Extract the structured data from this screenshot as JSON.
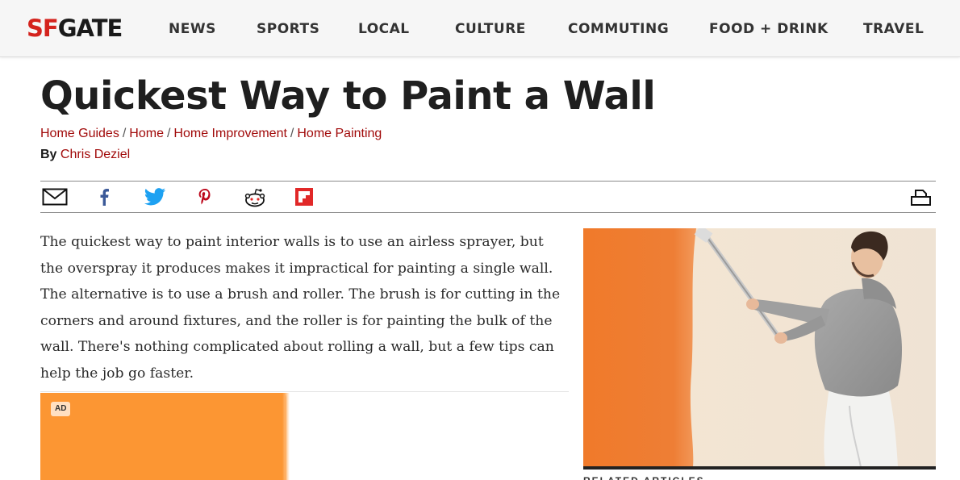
{
  "header": {
    "logo_sf": "SF",
    "logo_gate": "GATE",
    "nav": [
      {
        "label": "NEWS"
      },
      {
        "label": "SPORTS"
      },
      {
        "label": "LOCAL"
      },
      {
        "label": "CULTURE"
      },
      {
        "label": "COMMUTING"
      },
      {
        "label": "FOOD + DRINK"
      },
      {
        "label": "TRAVEL"
      }
    ]
  },
  "article": {
    "title": "Quickest Way to Paint a Wall",
    "breadcrumbs": [
      "Home Guides",
      "Home",
      "Home Improvement",
      "Home Painting"
    ],
    "breadcrumb_sep": "/",
    "byline_prefix": "By",
    "author": "Chris Deziel",
    "body": "The quickest way to paint interior walls is to use an airless sprayer, but the overspray it produces makes it impractical for painting a single wall. The alternative is to use a brush and roller. The brush is for cutting in the corners and around fixtures, and the roller is for painting the bulk of the wall. There's nothing complicated about rolling a wall, but a few tips can help the job go faster."
  },
  "share": {
    "icons": [
      "email-icon",
      "facebook-icon",
      "twitter-icon",
      "pinterest-icon",
      "reddit-icon",
      "flipboard-icon",
      "print-icon"
    ],
    "colors": {
      "facebook": "#3b5998",
      "twitter": "#1da1f2",
      "pinterest": "#bd081c",
      "flipboard": "#e12828"
    }
  },
  "ad": {
    "badge": "AD",
    "color": "#fc9633"
  },
  "photo": {
    "icon": "man-painting-wall-photo"
  },
  "related": {
    "label": "RELATED ARTICLES"
  },
  "colors": {
    "link": "#a10a0a",
    "brand_red": "#d4231d"
  }
}
